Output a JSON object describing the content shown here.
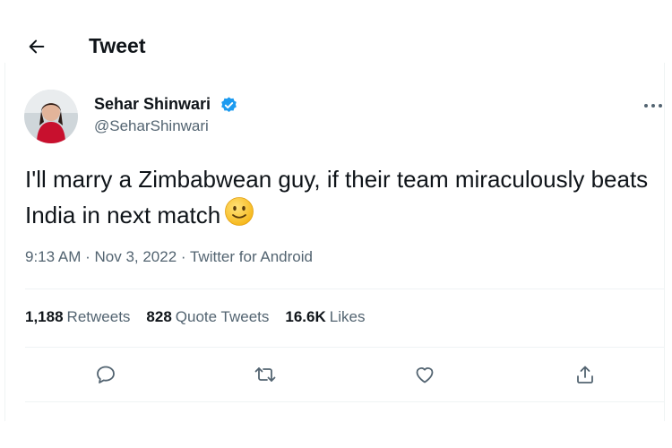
{
  "header": {
    "title": "Tweet"
  },
  "tweet": {
    "author": {
      "name": "Sehar Shinwari",
      "handle": "@SeharShinwari",
      "verified": true
    },
    "text": "I'll marry a Zimbabwean guy, if their team miraculously beats India in next match",
    "emoji": "slightly-smiling-face",
    "time": "9:13 AM",
    "date": "Nov 3, 2022",
    "source": "Twitter for Android",
    "separator": " · "
  },
  "stats": {
    "retweets_count": "1,188",
    "retweets_label": "Retweets",
    "quotes_count": "828",
    "quotes_label": "Quote Tweets",
    "likes_count": "16.6K",
    "likes_label": "Likes"
  },
  "icons": {
    "back": "arrow-left-icon",
    "more": "more-horizontal-icon",
    "reply": "reply-icon",
    "retweet": "retweet-icon",
    "like": "heart-icon",
    "share": "share-icon"
  },
  "colors": {
    "text": "#0f1419",
    "secondary": "#536471",
    "verified": "#1d9bf0",
    "divider": "#eff3f4"
  }
}
